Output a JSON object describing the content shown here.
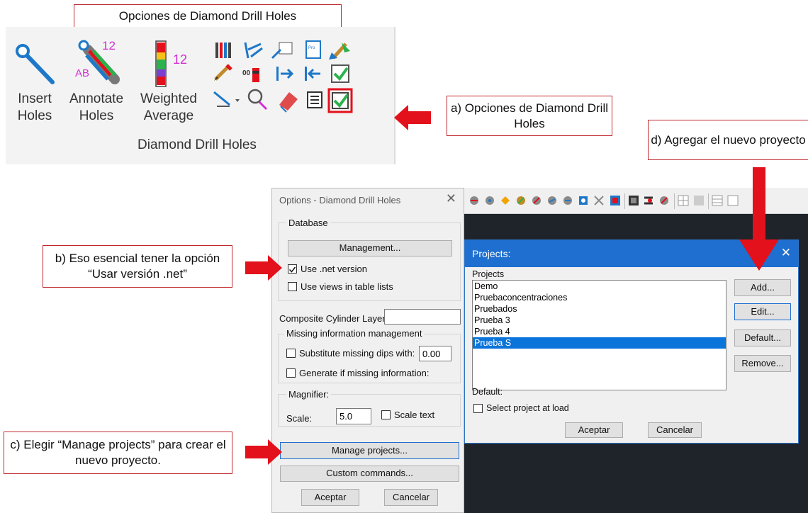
{
  "callouts": {
    "top_title": "Opciones de Diamond Drill Holes",
    "a": "a) Opciones de Diamond Drill Holes",
    "b": "b) Eso esencial tener la opción “Usar versión  .net”",
    "c": "c) Elegir “Manage projects” para crear el nuevo proyecto.",
    "d": "d) Agregar el nuevo proyecto"
  },
  "ribbon": {
    "insert_holes": "Insert Holes",
    "annotate_holes": "Annotate Holes",
    "weighted_average": "Weighted Average",
    "group_label": "Diamond Drill Holes",
    "badge_12a": "12",
    "badge_ab": "AB",
    "badge_12b": "12"
  },
  "options_dialog": {
    "title": "Options - Diamond Drill Holes",
    "close": "✕",
    "database_group": "Database",
    "management_button": "Management...",
    "use_net_version": "Use .net version",
    "use_views": "Use views in table lists",
    "composite_cylinder_layer": "Composite Cylinder Layer",
    "missing_group": "Missing information management",
    "substitute_missing": "Substitute missing dips with:",
    "substitute_value": "0.00",
    "generate_missing": "Generate if missing information:",
    "magnifier_group": "Magnifier:",
    "scale_label": "Scale:",
    "scale_value": "5.0",
    "scale_text": "Scale text",
    "manage_projects_button": "Manage projects...",
    "custom_commands_button": "Custom commands...",
    "accept_button": "Aceptar",
    "cancel_button": "Cancelar",
    "use_net_checked": true
  },
  "projects_dialog": {
    "title": "Projects:",
    "close": "✕",
    "list_label": "Projects",
    "items": [
      "Demo",
      "Pruebaconcentraciones",
      "Pruebados",
      "Prueba 3",
      "Prueba 4",
      "Prueba S"
    ],
    "selected_index": 5,
    "add_button": "Add...",
    "edit_button": "Edit...",
    "default_button": "Default...",
    "remove_button": "Remove...",
    "default_label": "Default:",
    "select_at_load": "Select project at load",
    "accept_button": "Aceptar",
    "cancel_button": "Cancelar"
  },
  "colors": {
    "callout_border": "#c0282d",
    "arrow_red": "#e3111b",
    "title_blue": "#1e6fd0",
    "selection_blue": "#0a74da",
    "dark_bg": "#1f242b"
  }
}
